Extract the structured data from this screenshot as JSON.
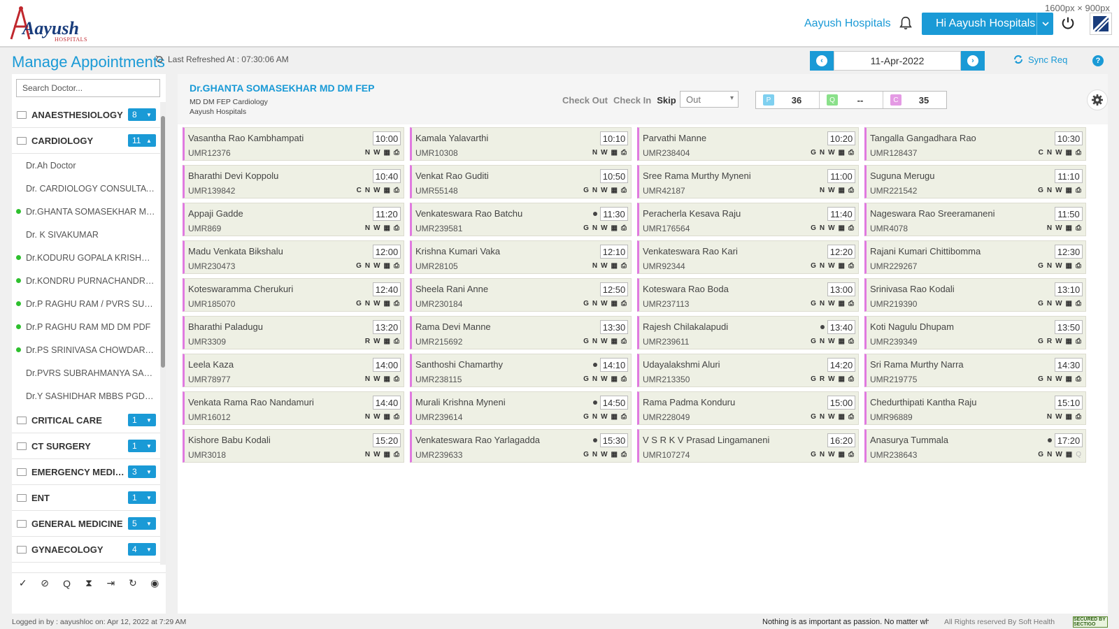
{
  "app": {
    "logo_text": "Aayush",
    "logo_sub": "HOSPITALS",
    "hospital_link": "Aayush Hospitals",
    "user_greeting": "Hi Aayush Hospitals",
    "screen_dims": "1600px × 900px"
  },
  "subheader": {
    "title": "Manage Appointments",
    "last_refreshed": "Last Refreshed At : 07:30:06 AM",
    "date": "11-Apr-2022",
    "sync_label": "Sync Req",
    "help_label": "?"
  },
  "sidebar": {
    "search_placeholder": "Search Doctor...",
    "departments_top": [
      {
        "name": "ANAESTHESIOLOGY",
        "count": "8",
        "arrow": "▼"
      },
      {
        "name": "CARDIOLOGY",
        "count": "11",
        "arrow": "▲"
      }
    ],
    "doctors": [
      {
        "name": "Dr.Ah Doctor",
        "online": false
      },
      {
        "name": "Dr. CARDIOLOGY CONSULTATION",
        "online": false
      },
      {
        "name": "Dr.GHANTA SOMASEKHAR MD DM FEP",
        "online": true
      },
      {
        "name": "Dr. K SIVAKUMAR",
        "online": false
      },
      {
        "name": "Dr.KODURU GOPALA KRISHNA MD",
        "online": true
      },
      {
        "name": "Dr.KONDRU PURNACHANDRA RAO",
        "online": true
      },
      {
        "name": "Dr.P RAGHU RAM / PVRS SUBRAHMANYA",
        "online": true
      },
      {
        "name": "Dr.P RAGHU RAM MD DM PDF",
        "online": true
      },
      {
        "name": "Dr.PS SRINIVASA CHOWDARY MD",
        "online": true
      },
      {
        "name": "Dr.PVRS SUBRAHMANYA SARMA",
        "online": false
      },
      {
        "name": "Dr.Y SASHIDHAR MBBS PGDCC",
        "online": false
      }
    ],
    "departments_bottom": [
      {
        "name": "CRITICAL CARE",
        "count": "1",
        "arrow": "▼"
      },
      {
        "name": "CT SURGERY",
        "count": "1",
        "arrow": "▼"
      },
      {
        "name": "EMERGENCY MEDICINE",
        "count": "3",
        "arrow": "▼"
      },
      {
        "name": "ENT",
        "count": "1",
        "arrow": "▼"
      },
      {
        "name": "GENERAL MEDICINE",
        "count": "5",
        "arrow": "▼"
      },
      {
        "name": "GYNAECOLOGY",
        "count": "4",
        "arrow": "▼"
      }
    ],
    "tools": [
      {
        "name": "check-icon",
        "glyph": "✓"
      },
      {
        "name": "circle-check-icon",
        "glyph": "⊘"
      },
      {
        "name": "queue-icon",
        "glyph": "Q"
      },
      {
        "name": "hourglass-icon",
        "glyph": "⧗"
      },
      {
        "name": "sign-in-icon",
        "glyph": "⇥"
      },
      {
        "name": "refresh-icon",
        "glyph": "↻"
      },
      {
        "name": "eye-icon",
        "glyph": "◉"
      }
    ]
  },
  "doctor_panel": {
    "name": "Dr.GHANTA SOMASEKHAR MD DM FEP",
    "qualification": "MD DM FEP Cardiology",
    "hospital": "Aayush Hospitals",
    "actions": {
      "check_out": "Check Out",
      "check_in": "Check In",
      "skip": "Skip"
    },
    "status_value": "Out",
    "counters": [
      {
        "tag": "P",
        "value": "36",
        "color": "#7fd0f0"
      },
      {
        "tag": "Q",
        "value": "--",
        "color": "#8ae08a"
      },
      {
        "tag": "C",
        "value": "35",
        "color": "#e49ae4"
      }
    ]
  },
  "appointments": [
    {
      "name": "Vasantha Rao Kambhampati",
      "umr": "UMR12376",
      "time": "10:00",
      "flags": [
        "N",
        "W"
      ],
      "dot": false
    },
    {
      "name": "Kamala Yalavarthi",
      "umr": "UMR10308",
      "time": "10:10",
      "flags": [
        "N",
        "W"
      ],
      "dot": false
    },
    {
      "name": "Parvathi Manne",
      "umr": "UMR238404",
      "time": "10:20",
      "flags": [
        "G",
        "N",
        "W"
      ],
      "dot": false
    },
    {
      "name": "Tangalla Gangadhara Rao",
      "umr": "UMR128437",
      "time": "10:30",
      "flags": [
        "C",
        "N",
        "W"
      ],
      "dot": false
    },
    {
      "name": "Bharathi Devi Koppolu",
      "umr": "UMR139842",
      "time": "10:40",
      "flags": [
        "C",
        "N",
        "W"
      ],
      "dot": false
    },
    {
      "name": "Venkat Rao Guditi",
      "umr": "UMR55148",
      "time": "10:50",
      "flags": [
        "G",
        "N",
        "W"
      ],
      "dot": false
    },
    {
      "name": "Sree Rama Murthy Myneni",
      "umr": "UMR42187",
      "time": "11:00",
      "flags": [
        "N",
        "W"
      ],
      "dot": false
    },
    {
      "name": "Suguna Merugu",
      "umr": "UMR221542",
      "time": "11:10",
      "flags": [
        "G",
        "N",
        "W"
      ],
      "dot": false
    },
    {
      "name": "Appaji Gadde",
      "umr": "UMR869",
      "time": "11:20",
      "flags": [
        "N",
        "W"
      ],
      "dot": false
    },
    {
      "name": "Venkateswara Rao Batchu",
      "umr": "UMR239581",
      "time": "11:30",
      "flags": [
        "G",
        "N",
        "W"
      ],
      "dot": true
    },
    {
      "name": "Peracherla Kesava Raju",
      "umr": "UMR176564",
      "time": "11:40",
      "flags": [
        "G",
        "N",
        "W"
      ],
      "dot": false
    },
    {
      "name": "Nageswara Rao Sreeramaneni",
      "umr": "UMR4078",
      "time": "11:50",
      "flags": [
        "N",
        "W"
      ],
      "dot": false
    },
    {
      "name": "Madu Venkata Bikshalu",
      "umr": "UMR230473",
      "time": "12:00",
      "flags": [
        "G",
        "N",
        "W"
      ],
      "dot": false
    },
    {
      "name": "Krishna Kumari Vaka",
      "umr": "UMR28105",
      "time": "12:10",
      "flags": [
        "N",
        "W"
      ],
      "dot": false
    },
    {
      "name": "Venkateswara Rao Kari",
      "umr": "UMR92344",
      "time": "12:20",
      "flags": [
        "G",
        "N",
        "W"
      ],
      "dot": false
    },
    {
      "name": "Rajani Kumari Chittibomma",
      "umr": "UMR229267",
      "time": "12:30",
      "flags": [
        "G",
        "N",
        "W"
      ],
      "dot": false
    },
    {
      "name": "Koteswaramma Cherukuri",
      "umr": "UMR185070",
      "time": "12:40",
      "flags": [
        "G",
        "N",
        "W"
      ],
      "dot": false
    },
    {
      "name": "Sheela Rani Anne",
      "umr": "UMR230184",
      "time": "12:50",
      "flags": [
        "G",
        "N",
        "W"
      ],
      "dot": false
    },
    {
      "name": "Koteswara Rao Boda",
      "umr": "UMR237113",
      "time": "13:00",
      "flags": [
        "G",
        "N",
        "W"
      ],
      "dot": false
    },
    {
      "name": "Srinivasa Rao Kodali",
      "umr": "UMR219390",
      "time": "13:10",
      "flags": [
        "G",
        "N",
        "W"
      ],
      "dot": false
    },
    {
      "name": "Bharathi Paladugu",
      "umr": "UMR3309",
      "time": "13:20",
      "flags": [
        "R",
        "W"
      ],
      "dot": false
    },
    {
      "name": "Rama Devi Manne",
      "umr": "UMR215692",
      "time": "13:30",
      "flags": [
        "G",
        "N",
        "W"
      ],
      "dot": false
    },
    {
      "name": "Rajesh Chilakalapudi",
      "umr": "UMR239611",
      "time": "13:40",
      "flags": [
        "G",
        "N",
        "W"
      ],
      "dot": true
    },
    {
      "name": "Koti Nagulu Dhupam",
      "umr": "UMR239349",
      "time": "13:50",
      "flags": [
        "G",
        "R",
        "W"
      ],
      "dot": false
    },
    {
      "name": "Leela Kaza",
      "umr": "UMR78977",
      "time": "14:00",
      "flags": [
        "N",
        "W"
      ],
      "dot": false
    },
    {
      "name": "Santhoshi Chamarthy",
      "umr": "UMR238115",
      "time": "14:10",
      "flags": [
        "G",
        "N",
        "W"
      ],
      "dot": true
    },
    {
      "name": "Udayalakshmi Aluri",
      "umr": "UMR213350",
      "time": "14:20",
      "flags": [
        "G",
        "R",
        "W"
      ],
      "dot": false
    },
    {
      "name": "Sri Rama Murthy Narra",
      "umr": "UMR219775",
      "time": "14:30",
      "flags": [
        "G",
        "N",
        "W"
      ],
      "dot": false
    },
    {
      "name": "Venkata Rama Rao Nandamuri",
      "umr": "UMR16012",
      "time": "14:40",
      "flags": [
        "N",
        "W"
      ],
      "dot": false
    },
    {
      "name": "Murali Krishna Myneni",
      "umr": "UMR239614",
      "time": "14:50",
      "flags": [
        "G",
        "N",
        "W"
      ],
      "dot": true
    },
    {
      "name": "Rama Padma Konduru",
      "umr": "UMR228049",
      "time": "15:00",
      "flags": [
        "G",
        "N",
        "W"
      ],
      "dot": false
    },
    {
      "name": "Chedurthipati Kantha Raju",
      "umr": "UMR96889",
      "time": "15:10",
      "flags": [
        "N",
        "W"
      ],
      "dot": false
    },
    {
      "name": "Kishore Babu Kodali",
      "umr": "UMR3018",
      "time": "15:20",
      "flags": [
        "N",
        "W"
      ],
      "dot": false
    },
    {
      "name": "Venkateswara Rao Yarlagadda",
      "umr": "UMR239633",
      "time": "15:30",
      "flags": [
        "G",
        "N",
        "W"
      ],
      "dot": true
    },
    {
      "name": "V S R K V Prasad Lingamaneni",
      "umr": "UMR107274",
      "time": "16:20",
      "flags": [
        "G",
        "N",
        "W"
      ],
      "dot": false
    },
    {
      "name": "Anasurya Tummala",
      "umr": "UMR238643",
      "time": "17:20",
      "flags": [
        "G",
        "N",
        "W"
      ],
      "dot": true,
      "queue": "Q"
    }
  ],
  "footer": {
    "login_info": "Logged in by : aayushloc on: Apr 12, 2022 at 7:29 AM",
    "ticker": "Nothing is as important as passion. No matter what you want to be in life",
    "rights": "All Rights reserved By Soft Health",
    "secured": "SECURED BY SECTIGO"
  }
}
